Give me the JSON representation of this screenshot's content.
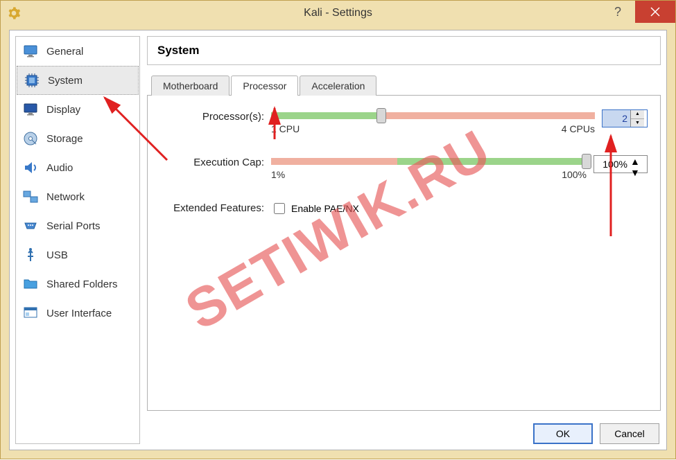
{
  "window": {
    "title": "Kali - Settings"
  },
  "sidebar": {
    "items": [
      {
        "label": "General"
      },
      {
        "label": "System"
      },
      {
        "label": "Display"
      },
      {
        "label": "Storage"
      },
      {
        "label": "Audio"
      },
      {
        "label": "Network"
      },
      {
        "label": "Serial Ports"
      },
      {
        "label": "USB"
      },
      {
        "label": "Shared Folders"
      },
      {
        "label": "User Interface"
      }
    ],
    "selected_index": 1
  },
  "page": {
    "title": "System"
  },
  "tabs": {
    "items": [
      {
        "label": "Motherboard"
      },
      {
        "label": "Processor"
      },
      {
        "label": "Acceleration"
      }
    ],
    "active_index": 1
  },
  "processor_tab": {
    "processors_label": "Processor(s):",
    "processors_min_label": "1 CPU",
    "processors_max_label": "4 CPUs",
    "processors_value": "2",
    "processors_thumb_pct": 34,
    "processors_green_pct": 34,
    "processors_red_start_pct": 34,
    "processors_red_end_pct": 100,
    "exec_cap_label": "Execution Cap:",
    "exec_cap_min_label": "1%",
    "exec_cap_max_label": "100%",
    "exec_cap_value": "100%",
    "exec_cap_thumb_pct": 100,
    "exec_cap_red_start_pct": 0,
    "exec_cap_red_end_pct": 40,
    "exec_cap_green_start_pct": 40,
    "exec_cap_green_end_pct": 100,
    "extended_label": "Extended Features:",
    "pae_label": "Enable PAE/NX",
    "pae_checked": false
  },
  "buttons": {
    "ok": "OK",
    "cancel": "Cancel"
  },
  "watermark": "SETIWIK.RU"
}
